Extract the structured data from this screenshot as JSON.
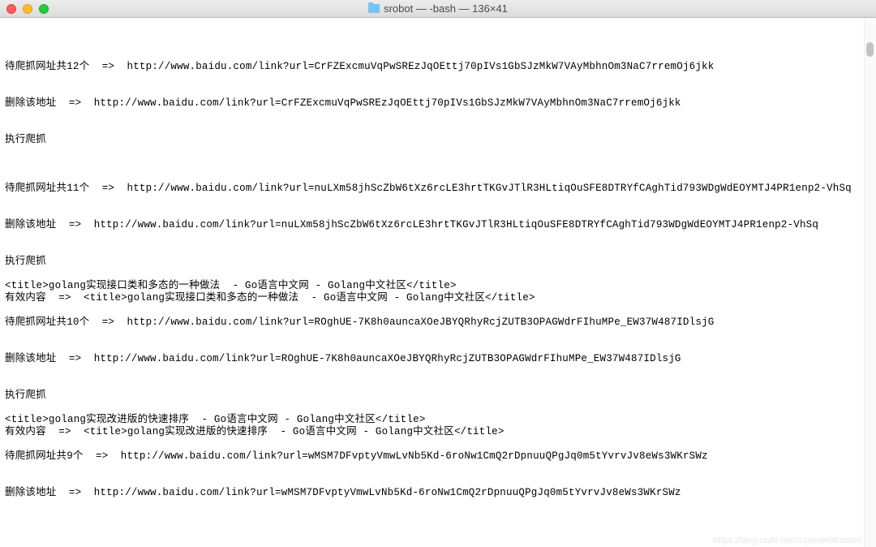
{
  "window": {
    "title": "srobot — -bash — 136×41"
  },
  "terminal": {
    "lines": [
      "",
      "",
      "",
      "待爬抓网址共12个  =>  http://www.baidu.com/link?url=CrFZExcmuVqPwSREzJqOEttj70pIVs1GbSJzMkW7VAyMbhnOm3NaC7rremOj6jkk",
      "",
      "",
      "删除该地址  =>  http://www.baidu.com/link?url=CrFZExcmuVqPwSREzJqOEttj70pIVs1GbSJzMkW7VAyMbhnOm3NaC7rremOj6jkk",
      "",
      "",
      "执行爬抓",
      "",
      "",
      "",
      "待爬抓网址共11个  =>  http://www.baidu.com/link?url=nuLXm58jhScZbW6tXz6rcLE3hrtTKGvJTlR3HLtiqOuSFE8DTRYfCAghTid793WDgWdEOYMTJ4PR1enp2-VhSq",
      "",
      "",
      "删除该地址  =>  http://www.baidu.com/link?url=nuLXm58jhScZbW6tXz6rcLE3hrtTKGvJTlR3HLtiqOuSFE8DTRYfCAghTid793WDgWdEOYMTJ4PR1enp2-VhSq",
      "",
      "",
      "执行爬抓",
      "",
      "<title>golang实现接口类和多态的一种做法  - Go语言中文网 - Golang中文社区</title>",
      "有效内容  =>  <title>golang实现接口类和多态的一种做法  - Go语言中文网 - Golang中文社区</title>",
      "",
      "待爬抓网址共10个  =>  http://www.baidu.com/link?url=ROghUE-7K8h0auncaXOeJBYQRhyRcjZUTB3OPAGWdrFIhuMPe_EW37W487IDlsjG",
      "",
      "",
      "删除该地址  =>  http://www.baidu.com/link?url=ROghUE-7K8h0auncaXOeJBYQRhyRcjZUTB3OPAGWdrFIhuMPe_EW37W487IDlsjG",
      "",
      "",
      "执行爬抓",
      "",
      "<title>golang实现改进版的快速排序  - Go语言中文网 - Golang中文社区</title>",
      "有效内容  =>  <title>golang实现改进版的快速排序  - Go语言中文网 - Golang中文社区</title>",
      "",
      "待爬抓网址共9个  =>  http://www.baidu.com/link?url=wMSM7DFvptyVmwLvNb5Kd-6roNw1CmQ2rDpnuuQPgJq0m5tYvrvJv8eWs3WKrSWz",
      "",
      "",
      "删除该地址  =>  http://www.baidu.com/link?url=wMSM7DFvptyVmwLvNb5Kd-6roNw1CmQ2rDpnuuQPgJq0m5tYvrvJv8eWs3WKrSWz",
      "",
      ""
    ]
  },
  "watermark": "https://blog.csdn.net/superwebmaster"
}
